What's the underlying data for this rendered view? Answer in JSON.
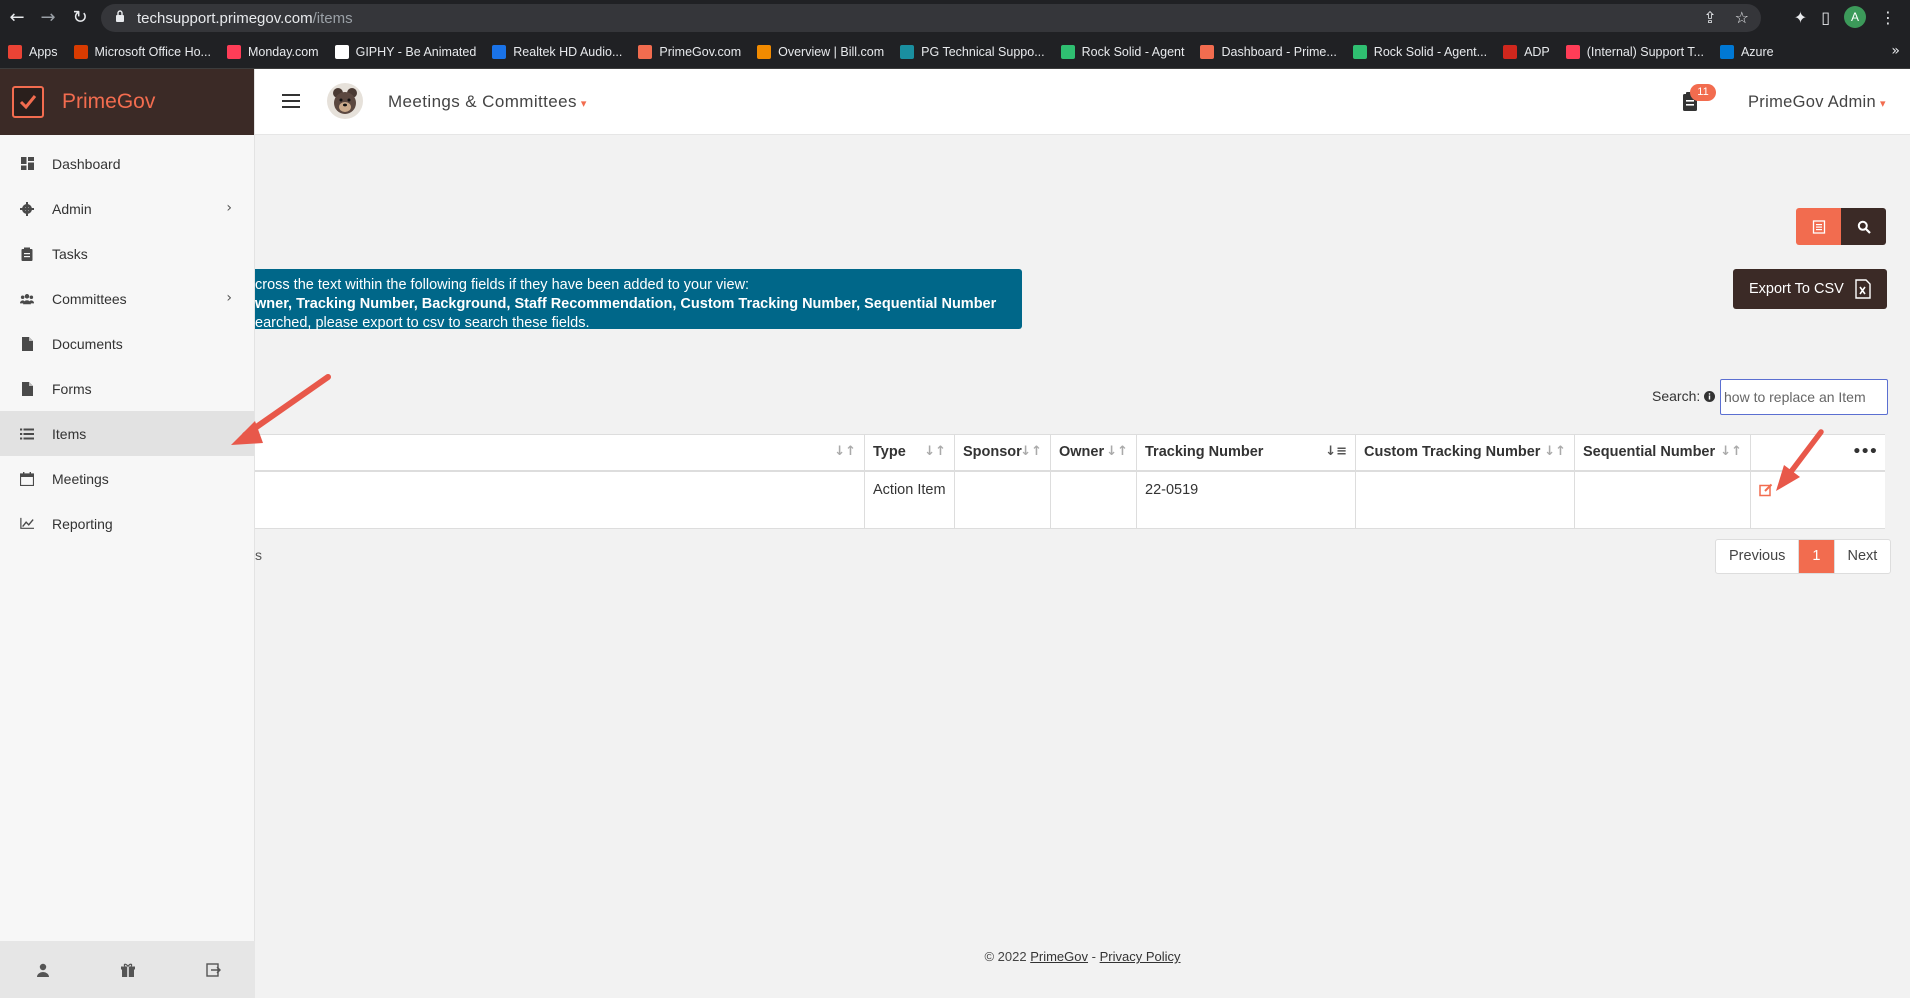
{
  "browser": {
    "url_host": "techsupport.primegov.com",
    "url_path": "/items",
    "profile_initial": "A",
    "bookmarks": [
      {
        "label": "Apps",
        "color": "#ea4335"
      },
      {
        "label": "Microsoft Office Ho...",
        "color": "#d83b01"
      },
      {
        "label": "Monday.com",
        "color": "#ff3d57"
      },
      {
        "label": "GIPHY - Be Animated",
        "color": "#ffffff"
      },
      {
        "label": "Realtek HD Audio...",
        "color": "#1a73e8"
      },
      {
        "label": "PrimeGov.com",
        "color": "#f26c4f"
      },
      {
        "label": "Overview | Bill.com",
        "color": "#f28b00"
      },
      {
        "label": "PG Technical Suppo...",
        "color": "#1a8fa0"
      },
      {
        "label": "Rock Solid - Agent",
        "color": "#2fbf71"
      },
      {
        "label": "Dashboard - Prime...",
        "color": "#f26c4f"
      },
      {
        "label": "Rock Solid - Agent...",
        "color": "#2fbf71"
      },
      {
        "label": "ADP",
        "color": "#d0271d"
      },
      {
        "label": "(Internal) Support T...",
        "color": "#ff3d57"
      },
      {
        "label": "Azure",
        "color": "#0078d4"
      }
    ]
  },
  "brand": {
    "name": "PrimeGov"
  },
  "sidebar": {
    "items": [
      {
        "label": "Dashboard",
        "icon": "dashboard-icon"
      },
      {
        "label": "Admin",
        "icon": "gear-icon",
        "chevron": "›"
      },
      {
        "label": "Tasks",
        "icon": "clipboard-icon"
      },
      {
        "label": "Committees",
        "icon": "users-icon",
        "chevron": "›"
      },
      {
        "label": "Documents",
        "icon": "file-icon"
      },
      {
        "label": "Forms",
        "icon": "file-icon"
      },
      {
        "label": "Items",
        "icon": "list-icon"
      },
      {
        "label": "Meetings",
        "icon": "calendar-icon"
      },
      {
        "label": "Reporting",
        "icon": "chart-line-icon"
      }
    ],
    "active_item": "Items"
  },
  "topbar": {
    "module": "Meetings & Committees",
    "notification_count": "11",
    "user": "PrimeGov Admin"
  },
  "content": {
    "info_banner": {
      "line1": "cross the text within the following fields if they have been added to your view:",
      "line2": "wner, Tracking Number, Background, Staff Recommendation, Custom Tracking Number, Sequential Number",
      "line3": "earched, please export to csv to search these fields."
    },
    "export_label": "Export To CSV",
    "search_label": "Search:",
    "search_value": "how to replace an Item",
    "table": {
      "headers": [
        "Type",
        "Sponsor",
        "Owner",
        "Tracking Number",
        "Custom Tracking Number",
        "Sequential Number"
      ],
      "rows": [
        {
          "type": "Action Item",
          "sponsor": "",
          "owner": "",
          "tracking_number": "22-0519",
          "custom_tracking_number": "",
          "sequential_number": ""
        }
      ]
    },
    "partial_info": "s",
    "pagination": {
      "previous": "Previous",
      "current": "1",
      "next": "Next"
    }
  },
  "footer": {
    "copyright": "© 2022",
    "company_link": "PrimeGov",
    "separator": "-",
    "privacy_link": "Privacy Policy"
  },
  "colors": {
    "accent": "#f26c4f",
    "brand_dark": "#3b2a26",
    "banner": "#006789",
    "annotation_arrow": "#e8584a"
  }
}
